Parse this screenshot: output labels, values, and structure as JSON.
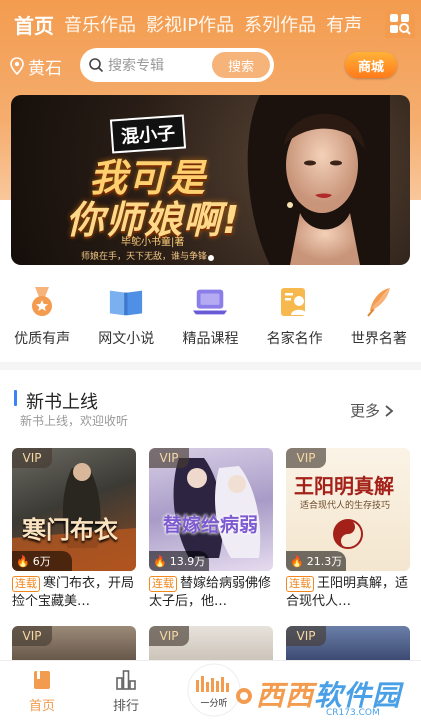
{
  "tabs": [
    "首页",
    "音乐作品",
    "影视IP作品",
    "系列作品",
    "有声"
  ],
  "grid_icon": "grid-search-icon",
  "location": {
    "icon": "location-pin-icon",
    "city": "黄石"
  },
  "search": {
    "placeholder": "搜索专辑",
    "button": "搜索"
  },
  "mall_label": "商城",
  "banner": {
    "badge": "混小子",
    "title_line1": "我可是",
    "title_line2": "你师娘啊!",
    "author": "毕鸵小书童|著",
    "slogan": "师娘在手，天下无敌，谁与争锋",
    "slides": 1,
    "active_slide": 0
  },
  "categories": [
    {
      "label": "优质有声",
      "icon": "medal-icon"
    },
    {
      "label": "网文小说",
      "icon": "open-book-icon"
    },
    {
      "label": "精品课程",
      "icon": "laptop-icon"
    },
    {
      "label": "名家名作",
      "icon": "author-card-icon"
    },
    {
      "label": "世界名著",
      "icon": "quill-icon"
    }
  ],
  "section": {
    "title": "新书上线",
    "subtitle": "新书上线，欢迎收听",
    "more": "更多"
  },
  "books": [
    {
      "vip": "VIP",
      "plays": "6万",
      "tag": "连载",
      "title": "寒门布衣，开局捡个宝藏美…",
      "cover_text": "寒门布衣"
    },
    {
      "vip": "VIP",
      "plays": "13.9万",
      "tag": "连载",
      "title": "替嫁给病弱佛修太子后，他…",
      "cover_text": "替嫁给病弱"
    },
    {
      "vip": "VIP",
      "plays": "21.3万",
      "tag": "连载",
      "title": "王阳明真解，适合现代人…",
      "cover_text": "王阳明真解",
      "cover_sub": "适合现代人的生存技巧"
    }
  ],
  "row2_vip": [
    "VIP",
    "VIP",
    "VIP"
  ],
  "nav": [
    {
      "label": "首页",
      "icon": "home-book-icon",
      "active": true
    },
    {
      "label": "排行",
      "icon": "ranking-bars-icon",
      "active": false
    }
  ],
  "watermark": {
    "brand": "西西",
    "suffix": "软件园",
    "url": "CR173.COM",
    "left_text": "一分听"
  },
  "colors": {
    "accent": "#f39c4f",
    "serial": "#f0871f",
    "section_bar": "#3b82f6"
  }
}
